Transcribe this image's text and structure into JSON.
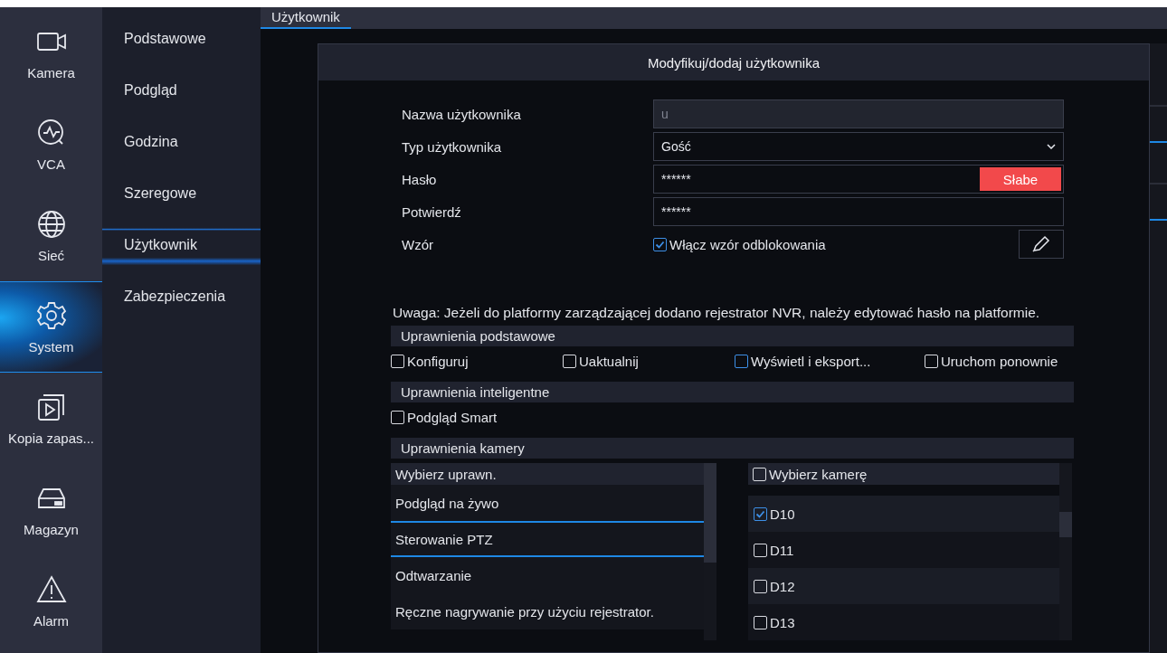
{
  "nav": [
    {
      "label": "Kamera",
      "selected": false
    },
    {
      "label": "VCA",
      "selected": false
    },
    {
      "label": "Sieć",
      "selected": false
    },
    {
      "label": "System",
      "selected": true
    },
    {
      "label": "Kopia zapas...",
      "selected": false
    },
    {
      "label": "Magazyn",
      "selected": false
    },
    {
      "label": "Alarm",
      "selected": false
    }
  ],
  "submenu": [
    {
      "label": "Podstawowe",
      "selected": false
    },
    {
      "label": "Podgląd",
      "selected": false
    },
    {
      "label": "Godzina",
      "selected": false
    },
    {
      "label": "Szeregowe",
      "selected": false
    },
    {
      "label": "Użytkownik",
      "selected": true
    },
    {
      "label": "Zabezpieczenia",
      "selected": false
    }
  ],
  "tabs": [
    {
      "label": "Użytkownik",
      "selected": true
    }
  ],
  "dialog": {
    "title": "Modyfikuj/dodaj użytkownika",
    "fields": [
      {
        "kind": "text",
        "label": "Nazwa użytkownika",
        "value": "u",
        "disabled": true
      },
      {
        "kind": "select",
        "label": "Typ użytkownika",
        "value": "Gość"
      },
      {
        "kind": "password",
        "label": "Hasło",
        "value": "******",
        "strength": "Słabe"
      },
      {
        "kind": "password",
        "label": "Potwierdź",
        "value": "******"
      },
      {
        "kind": "pattern",
        "label": "Wzór",
        "checkbox": "Włącz wzór odblokowania",
        "checked": true
      }
    ],
    "note": "Uwaga: Jeżeli do platformy zarządzającej dodano rejestrator NVR, należy edytować hasło na platformie.",
    "sections": [
      {
        "title": "Uprawnienia podstawowe",
        "options": [
          {
            "label": "Konfiguruj",
            "checked": false,
            "focused": false
          },
          {
            "label": "Uaktualnij",
            "checked": false,
            "focused": false
          },
          {
            "label": "Wyświetl i eksport...",
            "checked": false,
            "focused": true
          },
          {
            "label": "Uruchom ponownie",
            "checked": false,
            "focused": false
          }
        ]
      },
      {
        "title": "Uprawnienia inteligentne",
        "options": [
          {
            "label": "Podgląd Smart",
            "checked": false,
            "focused": false
          }
        ]
      },
      {
        "title": "Uprawnienia kamery"
      }
    ],
    "permissions": {
      "header": "Wybierz uprawn.",
      "items": [
        {
          "label": "Podgląd na żywo",
          "selected": false
        },
        {
          "label": "Sterowanie PTZ",
          "selected": true
        },
        {
          "label": "Odtwarzanie",
          "selected": false
        },
        {
          "label": "Ręczne nagrywanie przy użyciu rejestrator.",
          "selected": false
        }
      ]
    },
    "cameras": {
      "header": "Wybierz kamerę",
      "header_checked": false,
      "items": [
        {
          "label": "D10",
          "checked": true
        },
        {
          "label": "D11",
          "checked": false
        },
        {
          "label": "D12",
          "checked": false
        },
        {
          "label": "D13",
          "checked": false
        }
      ]
    }
  }
}
